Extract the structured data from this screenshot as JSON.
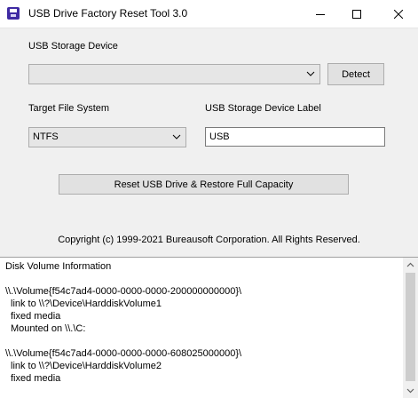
{
  "window": {
    "title": "USB Drive Factory Reset Tool 3.0",
    "icon": "usb-app-icon",
    "controls": [
      "minimize-icon",
      "maximize-icon",
      "close-icon"
    ]
  },
  "device": {
    "label": "USB Storage Device",
    "selected": "",
    "detect_label": "Detect"
  },
  "filesystem": {
    "label": "Target File System",
    "selected": "NTFS"
  },
  "volume_label": {
    "label": "USB Storage Device Label",
    "value": "USB"
  },
  "reset_button": "Reset USB Drive & Restore Full Capacity",
  "copyright": "Copyright (c) 1999-2021 Bureausoft Corporation. All Rights Reserved.",
  "info": {
    "title": "Disk Volume Information",
    "lines": [
      "\\\\.\\Volume{f54c7ad4-0000-0000-0000-200000000000}\\",
      "link to \\\\?\\Device\\HarddiskVolume1",
      "fixed media",
      "Mounted on \\\\.\\C:",
      "",
      "\\\\.\\Volume{f54c7ad4-0000-0000-0000-608025000000}\\",
      "link to \\\\?\\Device\\HarddiskVolume2",
      "fixed media"
    ]
  },
  "colors": {
    "titlebar": "#ffffff",
    "window_bg": "#f0f0f0",
    "button_bg": "#e1e1e1",
    "icon_accent": "#3f2aa3"
  }
}
